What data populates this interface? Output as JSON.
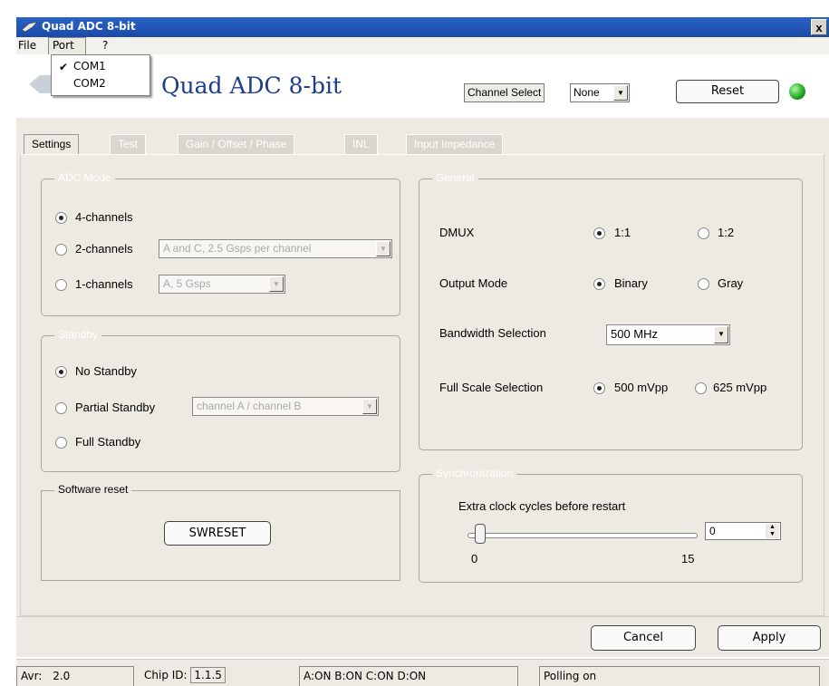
{
  "window": {
    "title": "Quad ADC 8-bit",
    "close_glyph": "x"
  },
  "menu": {
    "file": "File",
    "port": "Port",
    "help": "?"
  },
  "port_menu": {
    "items": [
      "COM1",
      "COM2"
    ],
    "checked_index": 0
  },
  "header": {
    "logo_text": "Quad ADC 8-bit",
    "channel_select_label": "Channel Select",
    "channel_select_value": "None",
    "reset_label": "Reset",
    "status_led_color": "#1ca51c"
  },
  "tabs": [
    "Settings",
    "Test",
    "Gain / Offset / Phase",
    "INL",
    "Input Impedance"
  ],
  "active_tab": 0,
  "adc_mode": {
    "title": "ADC Mode",
    "opt4": "4-channels",
    "opt2": "2-channels",
    "opt2_combo": "A and C, 2.5 Gsps per channel",
    "opt1": "1-channels",
    "opt1_combo": "A, 5 Gsps",
    "selected": "4-channels"
  },
  "standby": {
    "title": "Standby",
    "no": "No Standby",
    "partial": "Partial Standby",
    "partial_combo": "channel A / channel B",
    "full": "Full Standby",
    "selected": "No Standby"
  },
  "software_reset": {
    "title": "Software reset",
    "button": "SWRESET"
  },
  "general": {
    "title": "General",
    "dmux_label": "DMUX",
    "dmux_opt1": "1:1",
    "dmux_opt2": "1:2",
    "output_mode_label": "Output Mode",
    "output_binary": "Binary",
    "output_gray": "Gray",
    "bandwidth_label": "Bandwidth Selection",
    "bandwidth_value": "500 MHz",
    "full_scale_label": "Full Scale Selection",
    "fs_opt1": "500 mVpp",
    "fs_opt2": "625 mVpp"
  },
  "sync": {
    "title": "Synchronization",
    "label": "Extra clock cycles before restart",
    "min": "0",
    "max": "15",
    "value": "0"
  },
  "footer": {
    "cancel": "Cancel",
    "apply": "Apply"
  },
  "status": {
    "avr_label": "Avr:",
    "avr_value": "2.0",
    "chip_label": "Chip ID:",
    "chip_value": "1.1.5",
    "channels": "A:ON B:ON C:ON D:ON",
    "polling": "Polling on"
  }
}
